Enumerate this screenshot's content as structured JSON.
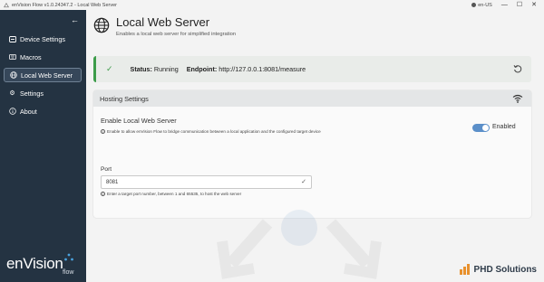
{
  "window": {
    "title": "enVision Flow v1.0.24347.2 - Local Web Server",
    "language": "en-US",
    "minimize_glyph": "—",
    "maximize_glyph": "☐",
    "close_glyph": "✕"
  },
  "sidebar": {
    "items": [
      {
        "label": "Device Settings",
        "icon": "device-settings-icon"
      },
      {
        "label": "Macros",
        "icon": "keyboard-icon"
      },
      {
        "label": "Local Web Server",
        "icon": "globe-icon",
        "active": true
      },
      {
        "label": "Settings",
        "icon": "gear-icon"
      },
      {
        "label": "About",
        "icon": "info-icon"
      }
    ],
    "brand_word": "enVision",
    "brand_flow": "flow"
  },
  "header": {
    "title": "Local Web Server",
    "subtitle": "Enables a local web server for simplified integration"
  },
  "status": {
    "status_label": "Status:",
    "status_value": "Running",
    "endpoint_label": "Endpoint:",
    "endpoint_value": "http://127.0.0.1:8081/measure"
  },
  "hosting": {
    "title": "Hosting Settings",
    "enable_label": "Enable Local Web Server",
    "enable_hint": "Enable to allow enVision Flow to bridge communication between a local application and the configured target device",
    "enabled": true,
    "toggle_label": "Enabled",
    "port_label": "Port",
    "port_value": "8081",
    "port_hint": "Enter a target port number, between 1 and 65535, to host the web server"
  },
  "footer": {
    "company": "PHD Solutions"
  },
  "colors": {
    "sidebar": "#243342",
    "status_accent": "#3d9c4a",
    "toggle_on": "#5b8fc9"
  }
}
